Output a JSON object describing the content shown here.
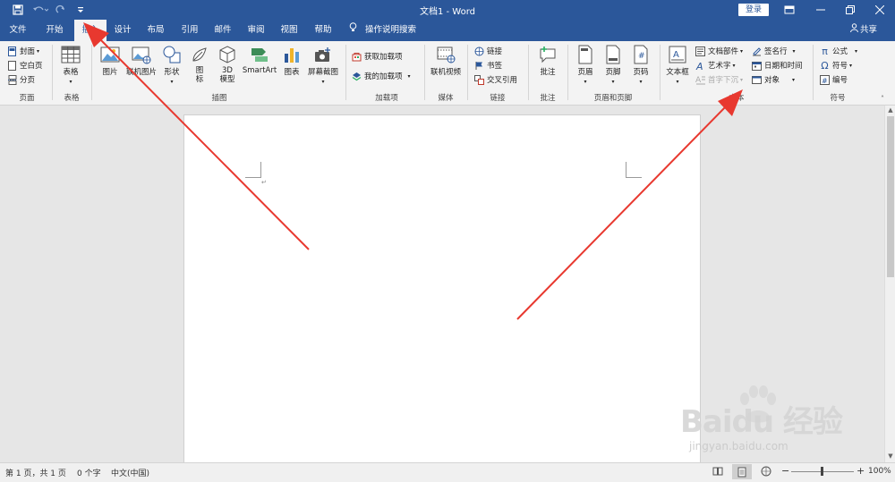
{
  "titlebar": {
    "title": "文档1 - Word",
    "signin": "登录",
    "icons": [
      "save-icon",
      "undo-icon",
      "redo-icon",
      "customize-icon",
      "ribbon-display-icon",
      "minimize-icon",
      "restore-icon",
      "close-icon"
    ]
  },
  "tabs": {
    "items": [
      "文件",
      "开始",
      "插入",
      "设计",
      "布局",
      "引用",
      "邮件",
      "审阅",
      "视图",
      "帮助"
    ],
    "active": "插入",
    "tellme": "操作说明搜索",
    "share": "共享"
  },
  "ribbon": {
    "pages": {
      "cover": "封面",
      "blank": "空白页",
      "break": "分页",
      "label": "页面"
    },
    "tables": {
      "table": "表格",
      "label": "表格"
    },
    "illustrations": {
      "pictures": "图片",
      "online_pictures": "联机图片",
      "shapes": "形状",
      "icons": "图标",
      "models": "3D 模型",
      "smartart": "SmartArt",
      "chart": "图表",
      "screenshot": "屏幕截图",
      "label": "插图"
    },
    "addins": {
      "get": "获取加载项",
      "mine": "我的加载项",
      "label": "加载项"
    },
    "media": {
      "online_video": "联机视频",
      "label": "媒体"
    },
    "links": {
      "link": "链接",
      "bookmark": "书签",
      "crossref": "交叉引用",
      "label": "链接"
    },
    "comments": {
      "comment": "批注",
      "label": "批注"
    },
    "header_footer": {
      "header": "页眉",
      "footer": "页脚",
      "page_number": "页码",
      "label": "页眉和页脚"
    },
    "text": {
      "textbox": "文本框",
      "quickparts": "文档部件",
      "wordart": "艺术字",
      "dropcap": "首字下沉",
      "signature": "签名行",
      "datetime": "日期和时间",
      "object": "对象",
      "label": "文本"
    },
    "symbols": {
      "equation": "公式",
      "symbol": "符号",
      "number": "编号",
      "label": "符号"
    }
  },
  "statusbar": {
    "page": "第 1 页，共 1 页",
    "words": "0 个字",
    "language": "中文(中国)",
    "zoom": "100%"
  },
  "watermark": {
    "main": "Baidu 经验",
    "url": "jingyan.baidu.com"
  },
  "colors": {
    "title_bg": "#2b579a",
    "arrow": "#e8382f"
  }
}
